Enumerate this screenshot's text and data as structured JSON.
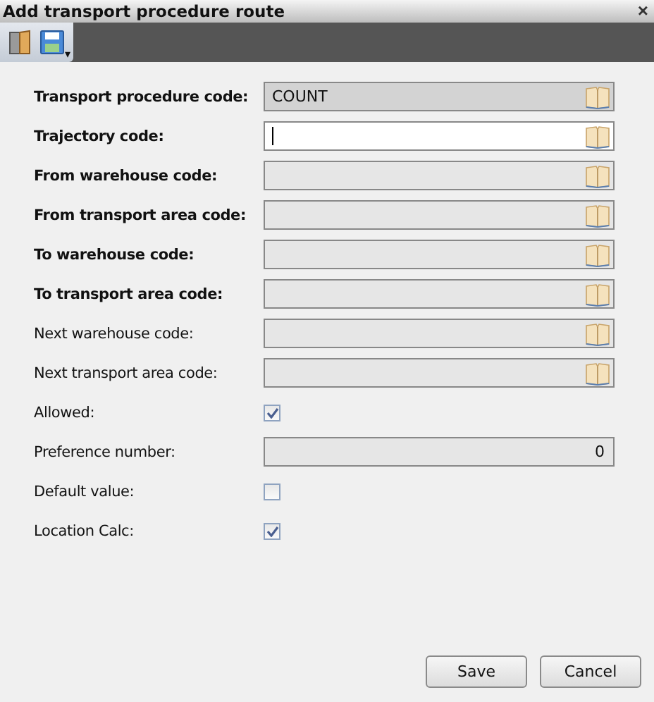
{
  "window": {
    "title": "Add transport procedure route",
    "close": "×"
  },
  "toolbar": {
    "overflow": "▾"
  },
  "fields": [
    {
      "kind": "lookup",
      "label": "Transport procedure code:",
      "required": true,
      "readonly": true,
      "focused": false,
      "value": "COUNT"
    },
    {
      "kind": "lookup",
      "label": "Trajectory code:",
      "required": true,
      "readonly": false,
      "focused": true
    },
    {
      "kind": "lookup",
      "label": "From warehouse code:",
      "required": true,
      "readonly": false,
      "focused": false
    },
    {
      "kind": "lookup",
      "label": "From transport area code:",
      "required": true,
      "readonly": false,
      "focused": false
    },
    {
      "kind": "lookup",
      "label": "To warehouse code:",
      "required": true,
      "readonly": false,
      "focused": false
    },
    {
      "kind": "lookup",
      "label": "To transport area code:",
      "required": true,
      "readonly": false,
      "focused": false
    },
    {
      "kind": "lookup",
      "label": "Next warehouse code:",
      "required": false,
      "readonly": false,
      "focused": false
    },
    {
      "kind": "lookup",
      "label": "Next transport area code:",
      "required": false,
      "readonly": false,
      "focused": false
    },
    {
      "kind": "checkbox",
      "label": "Allowed:",
      "required": false,
      "checked": true
    },
    {
      "kind": "number",
      "label": "Preference number:",
      "required": false,
      "readonly": false,
      "focused": false,
      "value": "0"
    },
    {
      "kind": "checkbox",
      "label": "Default value:",
      "required": false,
      "checked": false
    },
    {
      "kind": "checkbox",
      "label": "Location Calc:",
      "required": false,
      "checked": true
    }
  ],
  "buttons": [
    "Save",
    "Cancel"
  ]
}
